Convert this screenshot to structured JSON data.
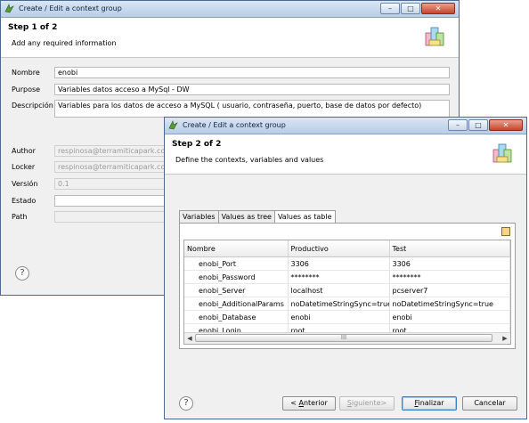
{
  "window1": {
    "title": "Create / Edit a context group",
    "step": "Step 1 of 2",
    "subtitle": "Add any required information",
    "fields": {
      "nombre": {
        "label": "Nombre",
        "value": "enobi"
      },
      "purpose": {
        "label": "Purpose",
        "value": "Variables datos acceso a MySql - DW"
      },
      "descripcion": {
        "label": "Descripción",
        "value": "Variables para los datos de acceso a MySQL ( usuario, contraseña, puerto, base de datos por defecto)"
      },
      "author": {
        "label": "Author",
        "value": "respinosa@terramiticapark.com"
      },
      "locker": {
        "label": "Locker",
        "value": "respinosa@terramiticapark.com"
      },
      "version": {
        "label": "Versión",
        "value": "0.1"
      },
      "estado": {
        "label": "Estado",
        "value": ""
      },
      "path": {
        "label": "Path",
        "value": ""
      }
    },
    "help": "?"
  },
  "window2": {
    "title": "Create / Edit a context group",
    "step": "Step 2 of 2",
    "subtitle": "Define the contexts, variables and values",
    "tabs": [
      "Variables",
      "Values as tree",
      "Values as table"
    ],
    "active_tab": "Values as table",
    "table": {
      "columns": [
        "Nombre",
        "Productivo",
        "Test"
      ],
      "rows": [
        [
          "enobi_Port",
          "3306",
          "3306"
        ],
        [
          "enobi_Password",
          "********",
          "********"
        ],
        [
          "enobi_Server",
          "localhost",
          "pcserver7"
        ],
        [
          "enobi_AdditionalParams",
          "noDatetimeStringSync=true",
          "noDatetimeStringSync=true"
        ],
        [
          "enobi_Database",
          "enobi",
          "enobi"
        ],
        [
          "enobi_Login",
          "root",
          "root"
        ]
      ]
    },
    "scroll_thumb": "III",
    "help": "?",
    "buttons": {
      "anterior_prefix": "< ",
      "anterior_accel": "A",
      "anterior_rest": "nterior",
      "siguiente_accel": "S",
      "siguiente_rest": "iguiente>",
      "finalizar_accel": "F",
      "finalizar_rest": "inalizar",
      "cancelar": "Cancelar"
    }
  },
  "colors": {
    "titlebar": "#c7d8ee",
    "accent": "#3a7fc4",
    "close": "#c7452a"
  }
}
